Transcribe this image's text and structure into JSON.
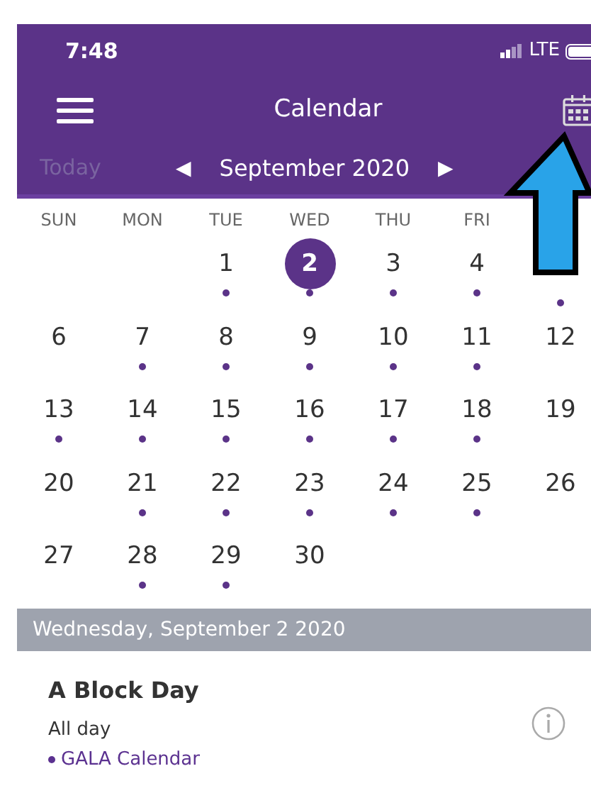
{
  "status_bar": {
    "time": "7:48",
    "network": "LTE"
  },
  "header": {
    "title": "Calendar"
  },
  "month_bar": {
    "today": "Today",
    "today_disabled": true,
    "month": "September 2020",
    "prev": "◀",
    "next": "▶"
  },
  "weekdays": [
    "SUN",
    "MON",
    "TUE",
    "WED",
    "THU",
    "FRI"
  ],
  "weeks": [
    [
      {
        "kind": "blank"
      },
      {
        "kind": "blank"
      },
      {
        "number": "1",
        "event": true,
        "selected": false
      },
      {
        "number": "2",
        "event": true,
        "selected": true
      },
      {
        "number": "3",
        "event": true,
        "selected": false
      },
      {
        "number": "4",
        "event": true,
        "selected": false
      },
      {
        "kind": "covered",
        "event": true
      }
    ],
    [
      {
        "number": "6",
        "event": false,
        "selected": false
      },
      {
        "number": "7",
        "event": true,
        "selected": false
      },
      {
        "number": "8",
        "event": true,
        "selected": false
      },
      {
        "number": "9",
        "event": true,
        "selected": false
      },
      {
        "number": "10",
        "event": true,
        "selected": false
      },
      {
        "number": "11",
        "event": true,
        "selected": false
      },
      {
        "number": "12",
        "event": false,
        "selected": false
      }
    ],
    [
      {
        "number": "13",
        "event": true,
        "selected": false
      },
      {
        "number": "14",
        "event": true,
        "selected": false
      },
      {
        "number": "15",
        "event": true,
        "selected": false
      },
      {
        "number": "16",
        "event": true,
        "selected": false
      },
      {
        "number": "17",
        "event": true,
        "selected": false
      },
      {
        "number": "18",
        "event": true,
        "selected": false
      },
      {
        "number": "19",
        "event": false,
        "selected": false
      }
    ],
    [
      {
        "number": "20",
        "event": false,
        "selected": false
      },
      {
        "number": "21",
        "event": true,
        "selected": false
      },
      {
        "number": "22",
        "event": true,
        "selected": false
      },
      {
        "number": "23",
        "event": true,
        "selected": false
      },
      {
        "number": "24",
        "event": true,
        "selected": false
      },
      {
        "number": "25",
        "event": true,
        "selected": false
      },
      {
        "number": "26",
        "event": false,
        "selected": false
      }
    ],
    [
      {
        "number": "27",
        "event": false,
        "selected": false
      },
      {
        "number": "28",
        "event": true,
        "selected": false
      },
      {
        "number": "29",
        "event": true,
        "selected": false
      },
      {
        "number": "30",
        "event": false,
        "selected": false
      },
      {
        "kind": "blank"
      },
      {
        "kind": "blank"
      },
      {
        "kind": "blank"
      }
    ]
  ],
  "day_header": "Wednesday, September 2 2020",
  "events": [
    {
      "title": "A Block Day",
      "time": "All day",
      "calendar": "GALA Calendar",
      "color": "#5b3190"
    }
  ]
}
